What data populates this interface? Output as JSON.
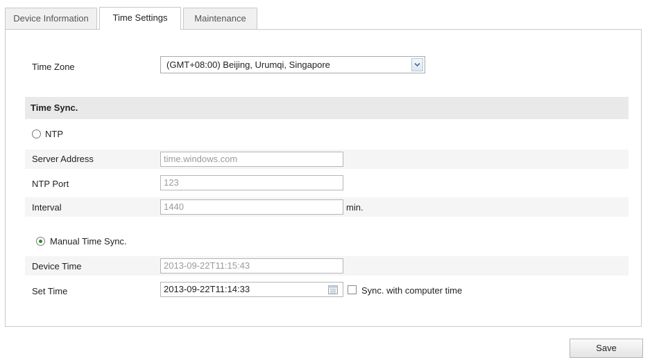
{
  "tabs": [
    {
      "label": "Device Information",
      "active": false
    },
    {
      "label": "Time Settings",
      "active": true
    },
    {
      "label": "Maintenance",
      "active": false
    }
  ],
  "time_zone": {
    "label": "Time Zone",
    "value": "(GMT+08:00) Beijing, Urumqi, Singapore"
  },
  "time_sync": {
    "title": "Time Sync.",
    "ntp": {
      "label": "NTP",
      "selected": false,
      "server_address": {
        "label": "Server Address",
        "value": "time.windows.com"
      },
      "ntp_port": {
        "label": "NTP Port",
        "value": "123"
      },
      "interval": {
        "label": "Interval",
        "value": "1440",
        "unit": "min."
      }
    },
    "manual": {
      "label": "Manual Time Sync.",
      "selected": true,
      "device_time": {
        "label": "Device Time",
        "value": "2013-09-22T11:15:43"
      },
      "set_time": {
        "label": "Set Time",
        "value": "2013-09-22T11:14:33"
      },
      "sync_with_computer": {
        "label": "Sync. with computer time",
        "checked": false
      }
    }
  },
  "save_label": "Save",
  "colors": {
    "radio_checked": "#2f8a2f",
    "section_header_bg": "#e9e9e9",
    "row_bg": "#f5f5f5"
  },
  "icons": [
    "chevron-down-icon",
    "calendar-icon"
  ]
}
